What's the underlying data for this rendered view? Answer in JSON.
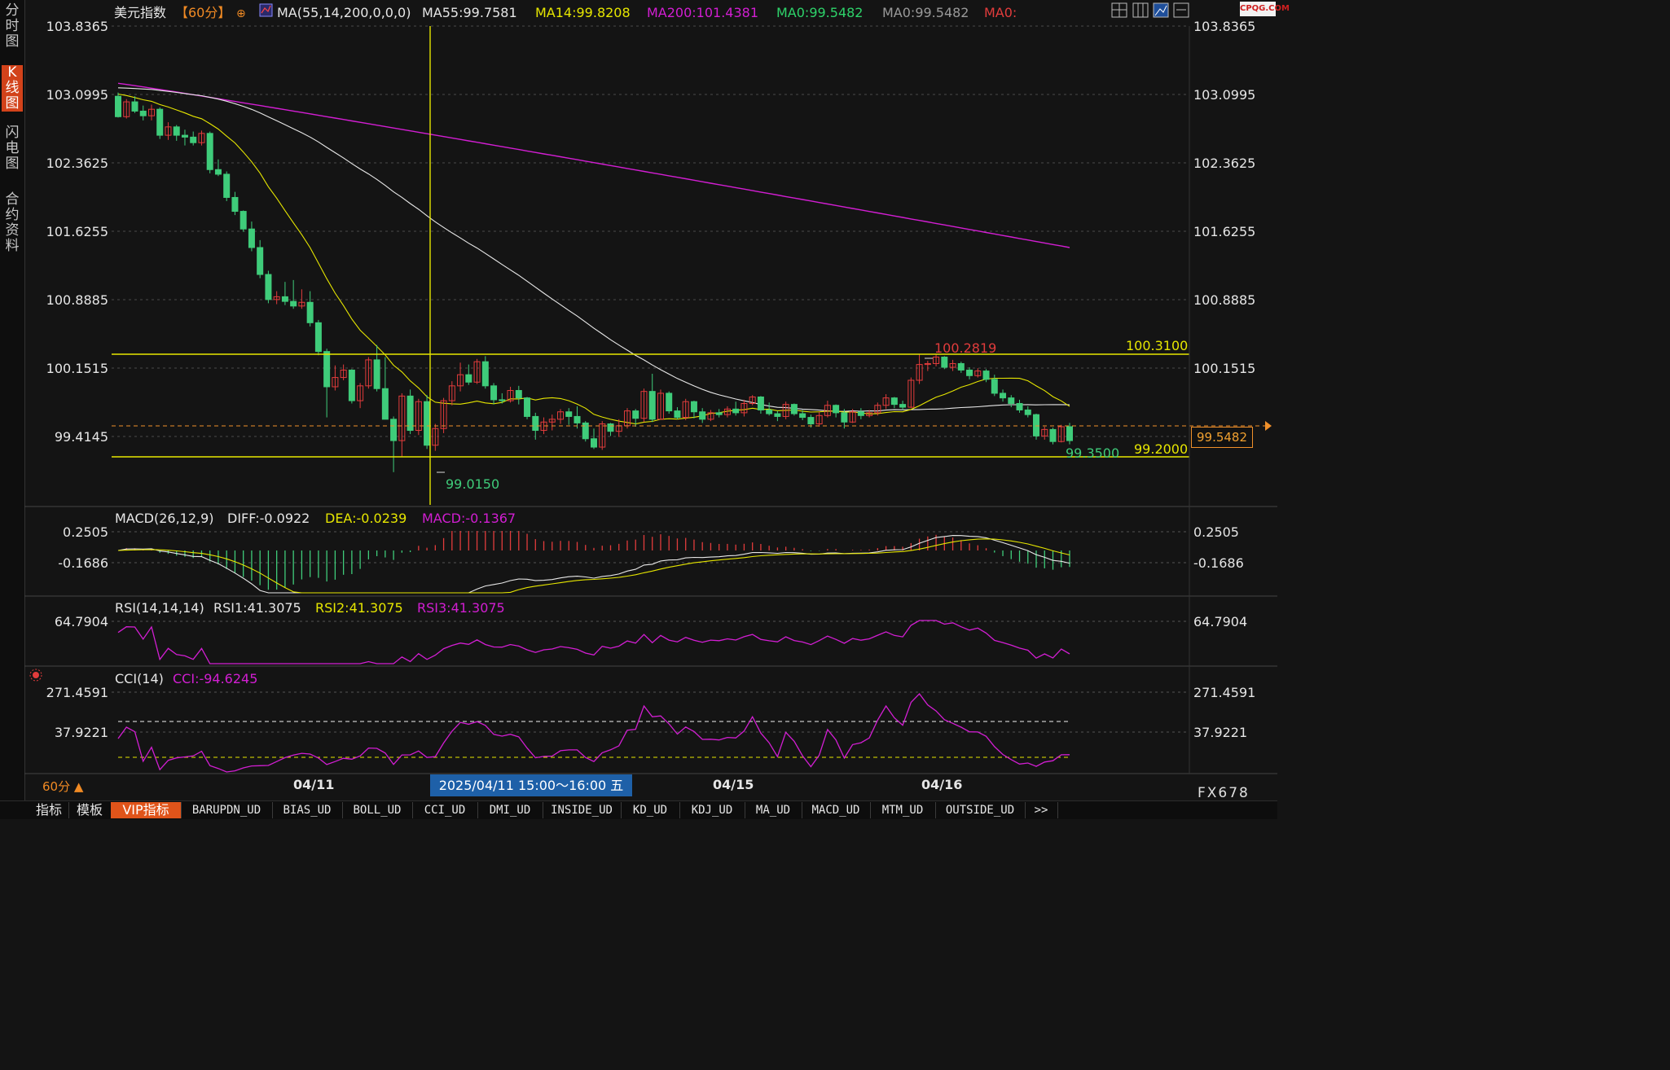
{
  "sidebar": {
    "tabs": [
      {
        "label": "分时图",
        "active": false
      },
      {
        "label": "K线图",
        "active": true
      },
      {
        "label": "闪电图",
        "active": false
      },
      {
        "label": "合约资料",
        "active": false
      }
    ]
  },
  "header": {
    "symbol": "美元指数",
    "period": "【60分】",
    "ma_params": "MA(55,14,200,0,0,0)",
    "ma55": "MA55:99.7581",
    "ma14": "MA14:99.8208",
    "ma200": "MA200:101.4381",
    "ma0_a": "MA0:99.5482",
    "ma0_b": "MA0:99.5482",
    "ma0_c": "MA0:"
  },
  "brand": "CPQG.COM",
  "price_axis": {
    "labels": [
      "103.8365",
      "103.0995",
      "102.3625",
      "101.6255",
      "100.8885",
      "100.1515",
      "99.4145"
    ]
  },
  "annotations": {
    "high_left": "100.2819",
    "high_right": "100.3100",
    "support": "99.2000",
    "low_left": "99.0150",
    "low_right": "99.3500",
    "current_price": "99.5482"
  },
  "macd": {
    "title": "MACD(26,12,9)",
    "diff": "DIFF:-0.0922",
    "dea": "DEA:-0.0239",
    "macd": "MACD:-0.1367",
    "axis": [
      "0.2505",
      "-0.1686"
    ]
  },
  "rsi": {
    "title": "RSI(14,14,14)",
    "rsi1": "RSI1:41.3075",
    "rsi2": "RSI2:41.3075",
    "rsi3": "RSI3:41.3075",
    "axis": [
      "64.7904"
    ]
  },
  "cci": {
    "title": "CCI(14)",
    "cci": "CCI:-94.6245",
    "axis": [
      "271.4591",
      "37.9221"
    ]
  },
  "x_axis": {
    "dates": [
      "04/11",
      "04/15",
      "04/16"
    ],
    "crosshair": "2025/04/11 15:00～16:00 五"
  },
  "period_selector": "60分 ▲",
  "instrument_code": "FX678",
  "bottom_tabs": [
    "指标",
    "模板",
    "VIP指标",
    "BARUPDN_UD",
    "BIAS_UD",
    "BOLL_UD",
    "CCI_UD",
    "DMI_UD",
    "INSIDE_UD",
    "KD_UD",
    "KDJ_UD",
    "MA_UD",
    "MACD_UD",
    "MTM_UD",
    "OUTSIDE_UD",
    ">>"
  ],
  "colors": {
    "up": "#e23c3c",
    "down": "#3fcc7a",
    "ma14": "#e6e600",
    "ma55": "#e8e8e8",
    "ma200": "#d21ed2",
    "dea": "#e6e600",
    "orange": "#f0902a"
  },
  "chart_data": {
    "type": "candlestick",
    "y_range": [
      98.8,
      104.0
    ],
    "ohlc": [
      [
        103.08,
        103.12,
        102.85,
        102.86
      ],
      [
        102.86,
        103.05,
        102.84,
        103.02
      ],
      [
        103.02,
        103.08,
        102.9,
        102.92
      ],
      [
        102.92,
        102.98,
        102.82,
        102.87
      ],
      [
        102.87,
        102.99,
        102.82,
        102.94
      ],
      [
        102.94,
        102.96,
        102.62,
        102.66
      ],
      [
        102.66,
        102.8,
        102.61,
        102.75
      ],
      [
        102.75,
        102.77,
        102.6,
        102.66
      ],
      [
        102.66,
        102.72,
        102.55,
        102.64
      ],
      [
        102.64,
        102.7,
        102.55,
        102.58
      ],
      [
        102.58,
        102.71,
        102.55,
        102.68
      ],
      [
        102.68,
        102.7,
        102.25,
        102.29
      ],
      [
        102.29,
        102.4,
        102.22,
        102.24
      ],
      [
        102.24,
        102.27,
        101.95,
        101.99
      ],
      [
        101.99,
        102.05,
        101.8,
        101.84
      ],
      [
        101.84,
        101.85,
        101.62,
        101.65
      ],
      [
        101.65,
        101.73,
        101.41,
        101.45
      ],
      [
        101.45,
        101.53,
        101.12,
        101.16
      ],
      [
        101.16,
        101.2,
        100.85,
        100.89
      ],
      [
        100.89,
        100.98,
        100.84,
        100.92
      ],
      [
        100.92,
        101.08,
        100.83,
        100.87
      ],
      [
        100.87,
        101.1,
        100.79,
        100.82
      ],
      [
        100.82,
        101.0,
        100.79,
        100.86
      ],
      [
        100.86,
        100.98,
        100.6,
        100.64
      ],
      [
        100.64,
        100.67,
        100.29,
        100.33
      ],
      [
        100.33,
        100.36,
        99.62,
        99.95
      ],
      [
        99.95,
        100.18,
        99.91,
        100.05
      ],
      [
        100.05,
        100.19,
        100.02,
        100.13
      ],
      [
        100.13,
        100.14,
        99.77,
        99.8
      ],
      [
        99.8,
        99.99,
        99.72,
        99.96
      ],
      [
        99.96,
        100.27,
        99.93,
        100.24
      ],
      [
        100.24,
        100.4,
        99.9,
        99.93
      ],
      [
        99.93,
        100.27,
        99.66,
        99.6
      ],
      [
        99.6,
        99.63,
        99.03,
        99.37
      ],
      [
        99.37,
        99.88,
        99.2,
        99.85
      ],
      [
        99.85,
        99.92,
        99.44,
        99.48
      ],
      [
        99.48,
        99.82,
        99.43,
        99.79
      ],
      [
        99.79,
        99.86,
        99.28,
        99.32
      ],
      [
        99.32,
        99.55,
        99.26,
        99.5
      ],
      [
        99.5,
        99.83,
        99.45,
        99.8
      ],
      [
        99.8,
        100.01,
        99.75,
        99.96
      ],
      [
        99.96,
        100.21,
        99.9,
        100.08
      ],
      [
        100.08,
        100.19,
        99.97,
        100.0
      ],
      [
        100.0,
        100.25,
        99.98,
        100.22
      ],
      [
        100.22,
        100.28,
        99.93,
        99.96
      ],
      [
        99.96,
        99.99,
        99.76,
        99.81
      ],
      [
        99.81,
        99.88,
        99.77,
        99.8
      ],
      [
        99.8,
        99.95,
        99.78,
        99.91
      ],
      [
        99.91,
        99.96,
        99.76,
        99.83
      ],
      [
        99.83,
        99.84,
        99.6,
        99.63
      ],
      [
        99.63,
        99.67,
        99.38,
        99.48
      ],
      [
        99.48,
        99.62,
        99.44,
        99.57
      ],
      [
        99.57,
        99.65,
        99.48,
        99.6
      ],
      [
        99.6,
        99.71,
        99.55,
        99.68
      ],
      [
        99.68,
        99.72,
        99.54,
        99.63
      ],
      [
        99.63,
        99.74,
        99.5,
        99.56
      ],
      [
        99.56,
        99.58,
        99.36,
        99.39
      ],
      [
        99.39,
        99.5,
        99.28,
        99.3
      ],
      [
        99.3,
        99.58,
        99.27,
        99.55
      ],
      [
        99.55,
        99.56,
        99.42,
        99.47
      ],
      [
        99.47,
        99.6,
        99.41,
        99.53
      ],
      [
        99.53,
        99.72,
        99.5,
        99.69
      ],
      [
        99.69,
        99.71,
        99.52,
        99.61
      ],
      [
        99.61,
        99.93,
        99.57,
        99.9
      ],
      [
        99.9,
        100.09,
        99.57,
        99.6
      ],
      [
        99.6,
        99.92,
        99.6,
        99.88
      ],
      [
        99.88,
        99.9,
        99.66,
        99.69
      ],
      [
        99.69,
        99.73,
        99.6,
        99.62
      ],
      [
        99.62,
        99.82,
        99.59,
        99.79
      ],
      [
        99.79,
        99.8,
        99.61,
        99.68
      ],
      [
        99.68,
        99.72,
        99.56,
        99.6
      ],
      [
        99.6,
        99.7,
        99.58,
        99.67
      ],
      [
        99.67,
        99.71,
        99.62,
        99.65
      ],
      [
        99.65,
        99.74,
        99.62,
        99.71
      ],
      [
        99.71,
        99.79,
        99.64,
        99.67
      ],
      [
        99.67,
        99.81,
        99.63,
        99.77
      ],
      [
        99.77,
        99.86,
        99.75,
        99.84
      ],
      [
        99.84,
        99.85,
        99.66,
        99.7
      ],
      [
        99.7,
        99.78,
        99.64,
        99.66
      ],
      [
        99.66,
        99.69,
        99.58,
        99.63
      ],
      [
        99.63,
        99.79,
        99.6,
        99.76
      ],
      [
        99.76,
        99.77,
        99.64,
        99.66
      ],
      [
        99.66,
        99.7,
        99.59,
        99.62
      ],
      [
        99.62,
        99.65,
        99.51,
        99.55
      ],
      [
        99.55,
        99.68,
        99.52,
        99.64
      ],
      [
        99.64,
        99.8,
        99.62,
        99.75
      ],
      [
        99.75,
        99.76,
        99.62,
        99.67
      ],
      [
        99.67,
        99.71,
        99.5,
        99.57
      ],
      [
        99.57,
        99.71,
        99.56,
        99.68
      ],
      [
        99.68,
        99.72,
        99.6,
        99.64
      ],
      [
        99.64,
        99.7,
        99.62,
        99.67
      ],
      [
        99.67,
        99.78,
        99.64,
        99.75
      ],
      [
        99.75,
        99.87,
        99.71,
        99.83
      ],
      [
        99.83,
        99.84,
        99.72,
        99.76
      ],
      [
        99.76,
        99.8,
        99.7,
        99.73
      ],
      [
        99.73,
        100.05,
        99.72,
        100.02
      ],
      [
        100.02,
        100.3,
        99.98,
        100.19
      ],
      [
        100.19,
        100.23,
        100.12,
        100.2
      ],
      [
        100.2,
        100.3,
        100.17,
        100.27
      ],
      [
        100.27,
        100.28,
        100.14,
        100.16
      ],
      [
        100.16,
        100.24,
        100.12,
        100.2
      ],
      [
        100.2,
        100.22,
        100.1,
        100.13
      ],
      [
        100.13,
        100.16,
        100.03,
        100.07
      ],
      [
        100.07,
        100.15,
        100.05,
        100.12
      ],
      [
        100.12,
        100.14,
        100.0,
        100.03
      ],
      [
        100.03,
        100.08,
        99.85,
        99.88
      ],
      [
        99.88,
        99.92,
        99.79,
        99.83
      ],
      [
        99.83,
        99.86,
        99.73,
        99.77
      ],
      [
        99.77,
        99.81,
        99.67,
        99.7
      ],
      [
        99.7,
        99.74,
        99.62,
        99.65
      ],
      [
        99.65,
        99.66,
        99.38,
        99.42
      ],
      [
        99.42,
        99.52,
        99.38,
        99.49
      ],
      [
        99.49,
        99.51,
        99.33,
        99.36
      ],
      [
        99.36,
        99.54,
        99.35,
        99.52
      ],
      [
        99.52,
        99.56,
        99.33,
        99.37
      ]
    ]
  }
}
